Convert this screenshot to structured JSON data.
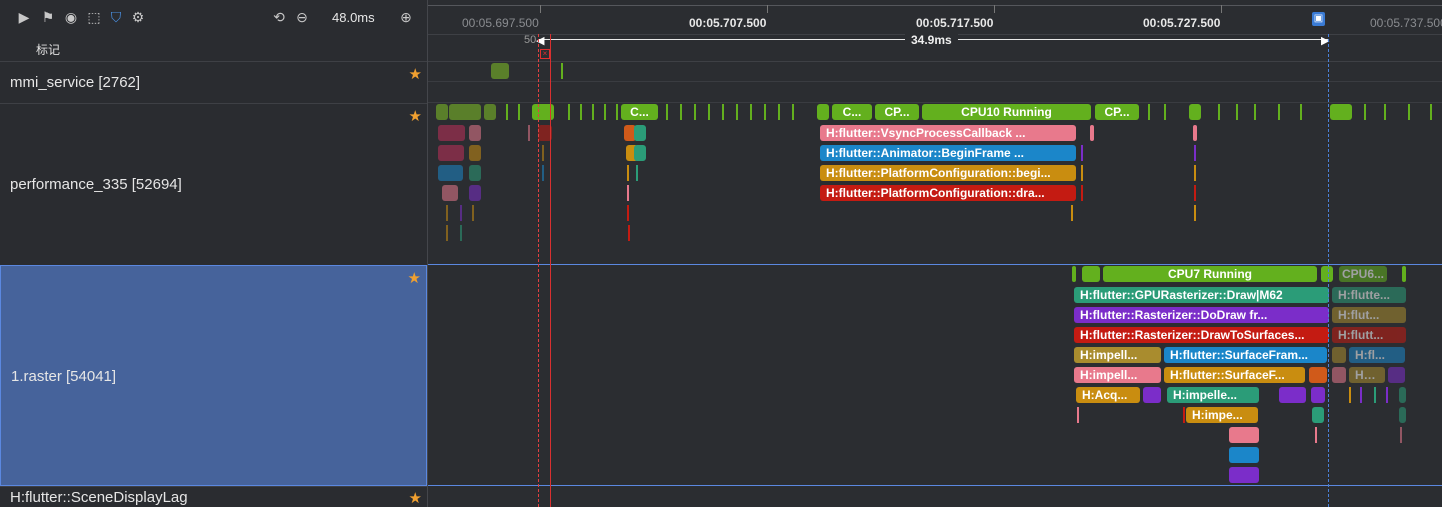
{
  "toolbar": {
    "zoom": "48.0ms",
    "marks_label": "标记"
  },
  "timeline": {
    "ticks": [
      "00:05.697.500",
      "00:05.707.500",
      "00:05.717.500",
      "00:05.727.500",
      "00:05.737.500"
    ],
    "range_start_label": "50",
    "range_label": "34.9ms"
  },
  "rows": [
    {
      "name": "mmi_service [2762]"
    },
    {
      "name": "performance_335 [52694]"
    },
    {
      "name": "1.raster [54041]"
    },
    {
      "name": "H:flutter::SceneDisplayLag"
    }
  ],
  "perf_slices": {
    "s1": "C...",
    "s2": "C...",
    "s3": "CP...",
    "cpu10": "CPU10 Running",
    "s4": "CP...",
    "vsync": "H:flutter::VsyncProcessCallback ...",
    "animator": "H:flutter::Animator::BeginFrame ...",
    "platcfg1": "H:flutter::PlatformConfiguration::begi...",
    "platcfg2": "H:flutter::PlatformConfiguration::dra..."
  },
  "raster_slices": {
    "cpu7": "CPU7 Running",
    "cpu6": "CPU6...",
    "gpu_draw": "H:flutter::GPURasterizer::Draw|M62",
    "gpu_draw_b": "H:flutte...",
    "dodraw": "H:flutter::Rasterizer::DoDraw fr...",
    "dodraw_b": "H:flut...",
    "drawsurf": "H:flutter::Rasterizer::DrawToSurfaces...",
    "drawsurf_b": "H:flutt...",
    "impell1": "H:impell...",
    "surfframe": "H:flutter::SurfaceFram...",
    "hfl": "H:fl...",
    "impell2": "H:impell...",
    "surfacef": "H:flutter::SurfaceF...",
    "hfl2": "H:fl...",
    "acq": "H:Acq...",
    "impelle": "H:impelle...",
    "impe": "H:impe..."
  }
}
